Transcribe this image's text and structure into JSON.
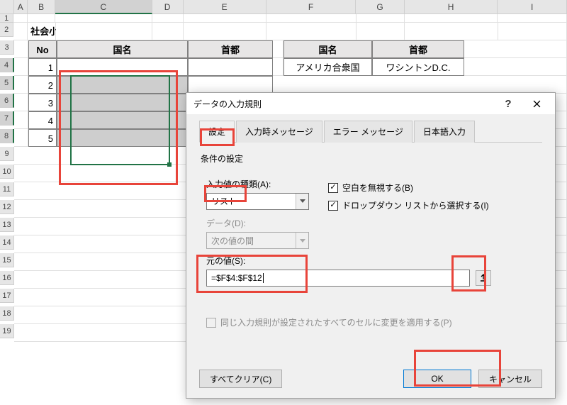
{
  "sheet": {
    "columns": [
      "A",
      "B",
      "C",
      "D",
      "E",
      "F",
      "G",
      "H",
      "I"
    ],
    "title_cell": "社会小テストの解答",
    "table1": {
      "headers": {
        "no": "No",
        "country": "国名",
        "capital": "首都"
      },
      "rows": [
        {
          "no": "1"
        },
        {
          "no": "2"
        },
        {
          "no": "3"
        },
        {
          "no": "4"
        },
        {
          "no": "5"
        }
      ]
    },
    "table2": {
      "headers": {
        "country": "国名",
        "capital": "首都"
      },
      "rows": [
        {
          "country": "アメリカ合衆国",
          "capital": "ワシントンD.C."
        }
      ]
    }
  },
  "dialog": {
    "title": "データの入力規則",
    "tabs": {
      "settings": "設定",
      "input_msg": "入力時メッセージ",
      "error_msg": "エラー メッセージ",
      "ime": "日本語入力"
    },
    "group_label": "条件の設定",
    "allow": {
      "label": "入力値の種類(A):",
      "value": "リスト"
    },
    "data": {
      "label": "データ(D):",
      "value": "次の値の間"
    },
    "blank": {
      "label": "空白を無視する(B)"
    },
    "dropdown": {
      "label": "ドロップダウン リストから選択する(I)"
    },
    "source": {
      "label": "元の値(S):",
      "value": "=$F$4:$F$12"
    },
    "apply_all": {
      "label": "同じ入力規則が設定されたすべてのセルに変更を適用する(P)"
    },
    "buttons": {
      "clear": "すべてクリア(C)",
      "ok": "OK",
      "cancel": "キャンセル"
    }
  }
}
